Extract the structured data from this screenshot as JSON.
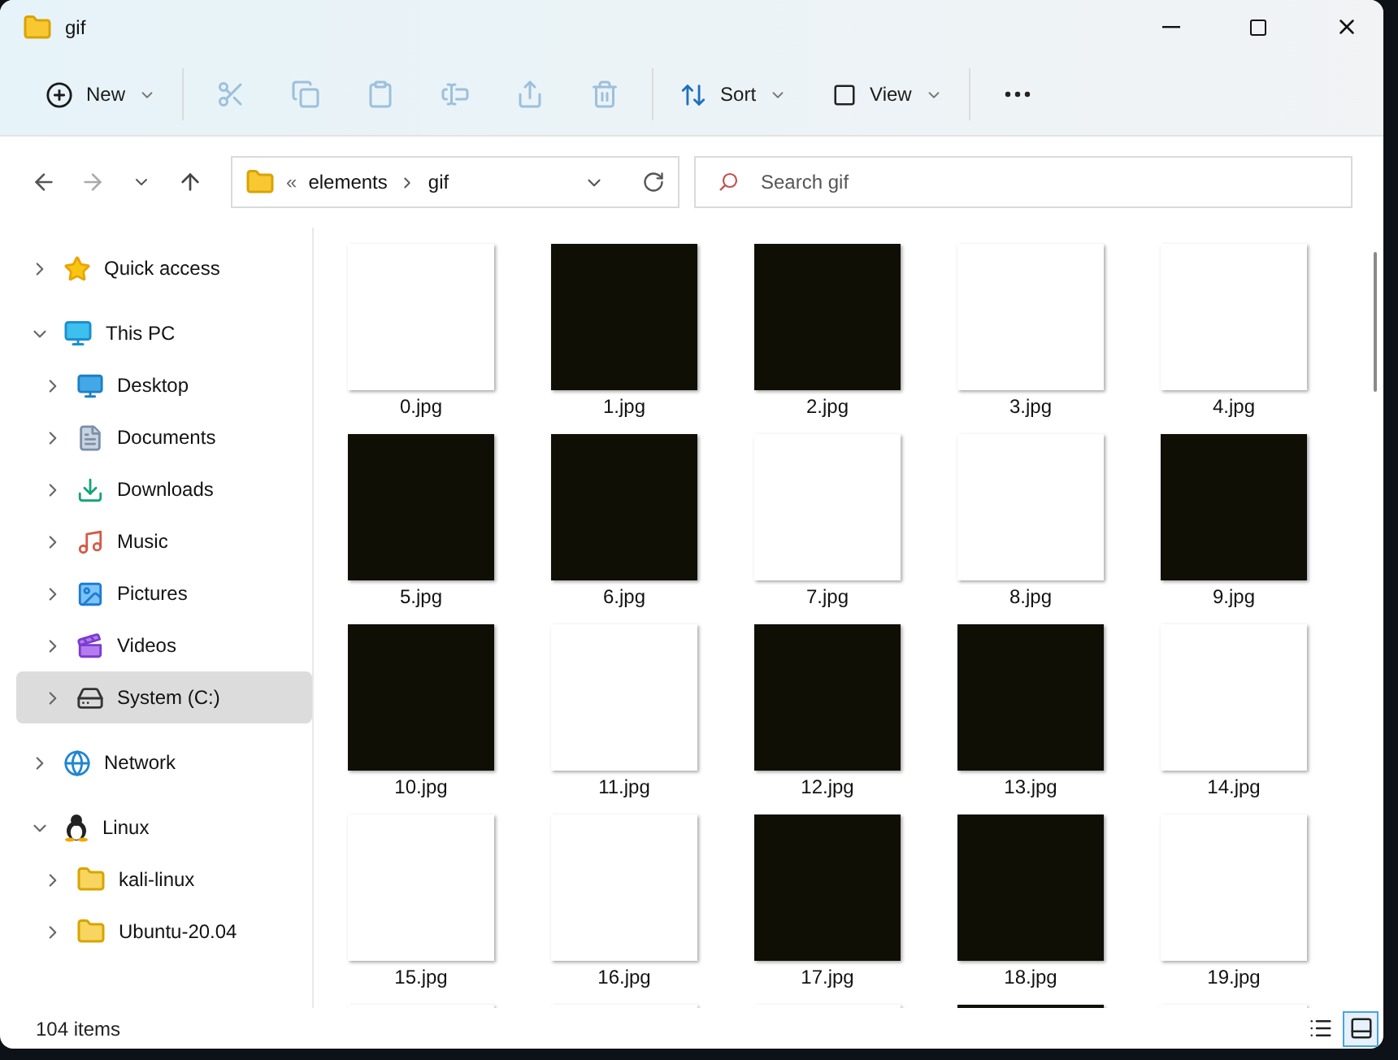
{
  "window": {
    "title": "gif"
  },
  "toolbar": {
    "new": {
      "label": "New"
    },
    "actions": [
      {
        "disabled": true
      },
      {
        "disabled": true
      },
      {
        "disabled": true
      },
      {
        "disabled": true
      },
      {
        "disabled": true
      },
      {
        "disabled": true
      }
    ],
    "sort": {
      "label": "Sort"
    },
    "view": {
      "label": "View"
    }
  },
  "address": {
    "overflow": "«",
    "path": [
      "elements",
      "gif"
    ]
  },
  "search": {
    "placeholder": "Search gif"
  },
  "sidebar": {
    "items": [
      {
        "label": "Quick access",
        "expanded": false,
        "selected": false
      },
      {
        "label": "This PC",
        "expanded": true,
        "selected": false,
        "children": [
          {
            "label": "Desktop",
            "expanded": false,
            "selected": false
          },
          {
            "label": "Documents",
            "expanded": false,
            "selected": false
          },
          {
            "label": "Downloads",
            "expanded": false,
            "selected": false
          },
          {
            "label": "Music",
            "expanded": false,
            "selected": false
          },
          {
            "label": "Pictures",
            "expanded": false,
            "selected": false
          },
          {
            "label": "Videos",
            "expanded": false,
            "selected": false
          },
          {
            "label": "System (C:)",
            "expanded": false,
            "selected": true
          }
        ]
      },
      {
        "label": "Network",
        "expanded": false,
        "selected": false
      },
      {
        "label": "Linux",
        "expanded": true,
        "selected": false,
        "children": [
          {
            "label": "kali-linux",
            "expanded": false,
            "selected": false
          },
          {
            "label": "Ubuntu-20.04",
            "expanded": false,
            "selected": false
          }
        ]
      }
    ]
  },
  "files": [
    {
      "name": "0.jpg",
      "kind": "light"
    },
    {
      "name": "1.jpg",
      "kind": "dark"
    },
    {
      "name": "2.jpg",
      "kind": "dark"
    },
    {
      "name": "3.jpg",
      "kind": "light"
    },
    {
      "name": "4.jpg",
      "kind": "light"
    },
    {
      "name": "5.jpg",
      "kind": "dark"
    },
    {
      "name": "6.jpg",
      "kind": "dark"
    },
    {
      "name": "7.jpg",
      "kind": "light"
    },
    {
      "name": "8.jpg",
      "kind": "light"
    },
    {
      "name": "9.jpg",
      "kind": "dark"
    },
    {
      "name": "10.jpg",
      "kind": "dark"
    },
    {
      "name": "11.jpg",
      "kind": "light"
    },
    {
      "name": "12.jpg",
      "kind": "dark"
    },
    {
      "name": "13.jpg",
      "kind": "dark"
    },
    {
      "name": "14.jpg",
      "kind": "light"
    },
    {
      "name": "15.jpg",
      "kind": "light"
    },
    {
      "name": "16.jpg",
      "kind": "light"
    },
    {
      "name": "17.jpg",
      "kind": "dark"
    },
    {
      "name": "18.jpg",
      "kind": "dark"
    },
    {
      "name": "19.jpg",
      "kind": "light"
    }
  ],
  "partial_row": [
    {
      "kind": "light"
    },
    {
      "kind": "light"
    },
    {
      "kind": "light"
    },
    {
      "kind": "dark"
    },
    {
      "kind": "light"
    }
  ],
  "status_bar": {
    "count": "104 items",
    "views": [
      {
        "selected": false
      },
      {
        "selected": true
      }
    ]
  }
}
